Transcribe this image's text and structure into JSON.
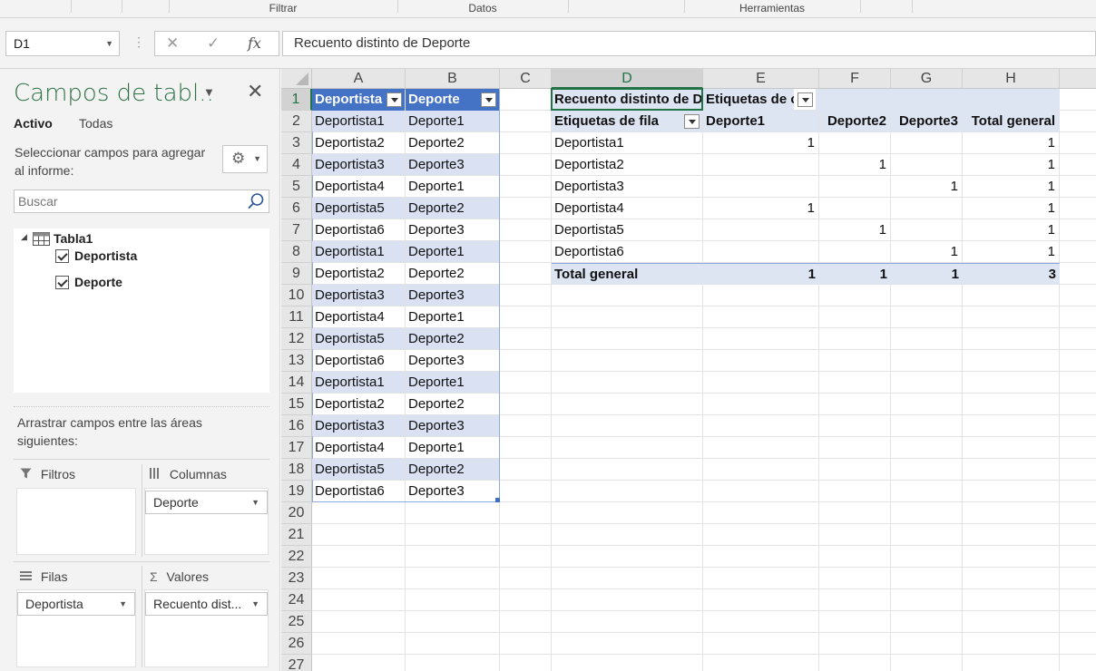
{
  "ribbon": {
    "groups": [
      "Filtrar",
      "Datos",
      "Herramientas"
    ]
  },
  "formula_bar": {
    "name_box": "D1",
    "cancel_icon": "✕",
    "enter_icon": "✓",
    "fx_label": "fx",
    "formula": "Recuento distinto de Deporte"
  },
  "pane": {
    "title": "Campos de tabl..",
    "tabs": {
      "active": "Activo",
      "all": "Todas"
    },
    "select_hint": "Seleccionar campos para agregar al informe:",
    "search_placeholder": "Buscar",
    "table_name": "Tabla1",
    "fields": [
      {
        "label": "Deportista",
        "checked": true
      },
      {
        "label": "Deporte",
        "checked": true
      }
    ],
    "drag_hint": "Arrastrar campos entre las áreas siguientes:",
    "areas": {
      "filters": {
        "label": "Filtros"
      },
      "columns": {
        "label": "Columnas",
        "chip": "Deporte"
      },
      "rows": {
        "label": "Filas",
        "chip": "Deportista"
      },
      "values": {
        "label": "Valores",
        "chip": "Recuento dist..."
      }
    }
  },
  "sheet": {
    "columns": [
      "A",
      "B",
      "C",
      "D",
      "E",
      "F",
      "G",
      "H"
    ],
    "rows": [
      "1",
      "2",
      "3",
      "4",
      "5",
      "6",
      "7",
      "8",
      "9",
      "10",
      "11",
      "12",
      "13",
      "14",
      "15",
      "16",
      "17",
      "18",
      "19",
      "20",
      "21",
      "22",
      "23",
      "24",
      "25",
      "26",
      "27"
    ],
    "table_headers": [
      "Deportista",
      "Deporte"
    ],
    "table_rows": [
      [
        "Deportista1",
        "Deporte1"
      ],
      [
        "Deportista2",
        "Deporte2"
      ],
      [
        "Deportista3",
        "Deporte3"
      ],
      [
        "Deportista4",
        "Deporte1"
      ],
      [
        "Deportista5",
        "Deporte2"
      ],
      [
        "Deportista6",
        "Deporte3"
      ],
      [
        "Deportista1",
        "Deporte1"
      ],
      [
        "Deportista2",
        "Deporte2"
      ],
      [
        "Deportista3",
        "Deporte3"
      ],
      [
        "Deportista4",
        "Deporte1"
      ],
      [
        "Deportista5",
        "Deporte2"
      ],
      [
        "Deportista6",
        "Deporte3"
      ],
      [
        "Deportista1",
        "Deporte1"
      ],
      [
        "Deportista2",
        "Deporte2"
      ],
      [
        "Deportista3",
        "Deporte3"
      ],
      [
        "Deportista4",
        "Deporte1"
      ],
      [
        "Deportista5",
        "Deporte2"
      ],
      [
        "Deportista6",
        "Deporte3"
      ]
    ],
    "pivot": {
      "value_label": "Recuento distinto de Deporte",
      "col_labels_caption": "Etiquetas de columna",
      "row_labels_caption": "Etiquetas de fila",
      "column_items": [
        "Deporte1",
        "Deporte2",
        "Deporte3",
        "Total general"
      ],
      "rows": [
        {
          "label": "Deportista1",
          "values": [
            "1",
            "",
            "",
            "1"
          ]
        },
        {
          "label": "Deportista2",
          "values": [
            "",
            "1",
            "",
            "1"
          ]
        },
        {
          "label": "Deportista3",
          "values": [
            "",
            "",
            "1",
            "1"
          ]
        },
        {
          "label": "Deportista4",
          "values": [
            "1",
            "",
            "",
            "1"
          ]
        },
        {
          "label": "Deportista5",
          "values": [
            "",
            "1",
            "",
            "1"
          ]
        },
        {
          "label": "Deportista6",
          "values": [
            "",
            "",
            "1",
            "1"
          ]
        }
      ],
      "total": {
        "label": "Total general",
        "values": [
          "1",
          "1",
          "1",
          "3"
        ]
      }
    }
  },
  "colors": {
    "accent_green": "#217346",
    "table_header_blue": "#4472c4",
    "table_band": "#d9e1f2",
    "pivot_band": "#dde5f3"
  }
}
